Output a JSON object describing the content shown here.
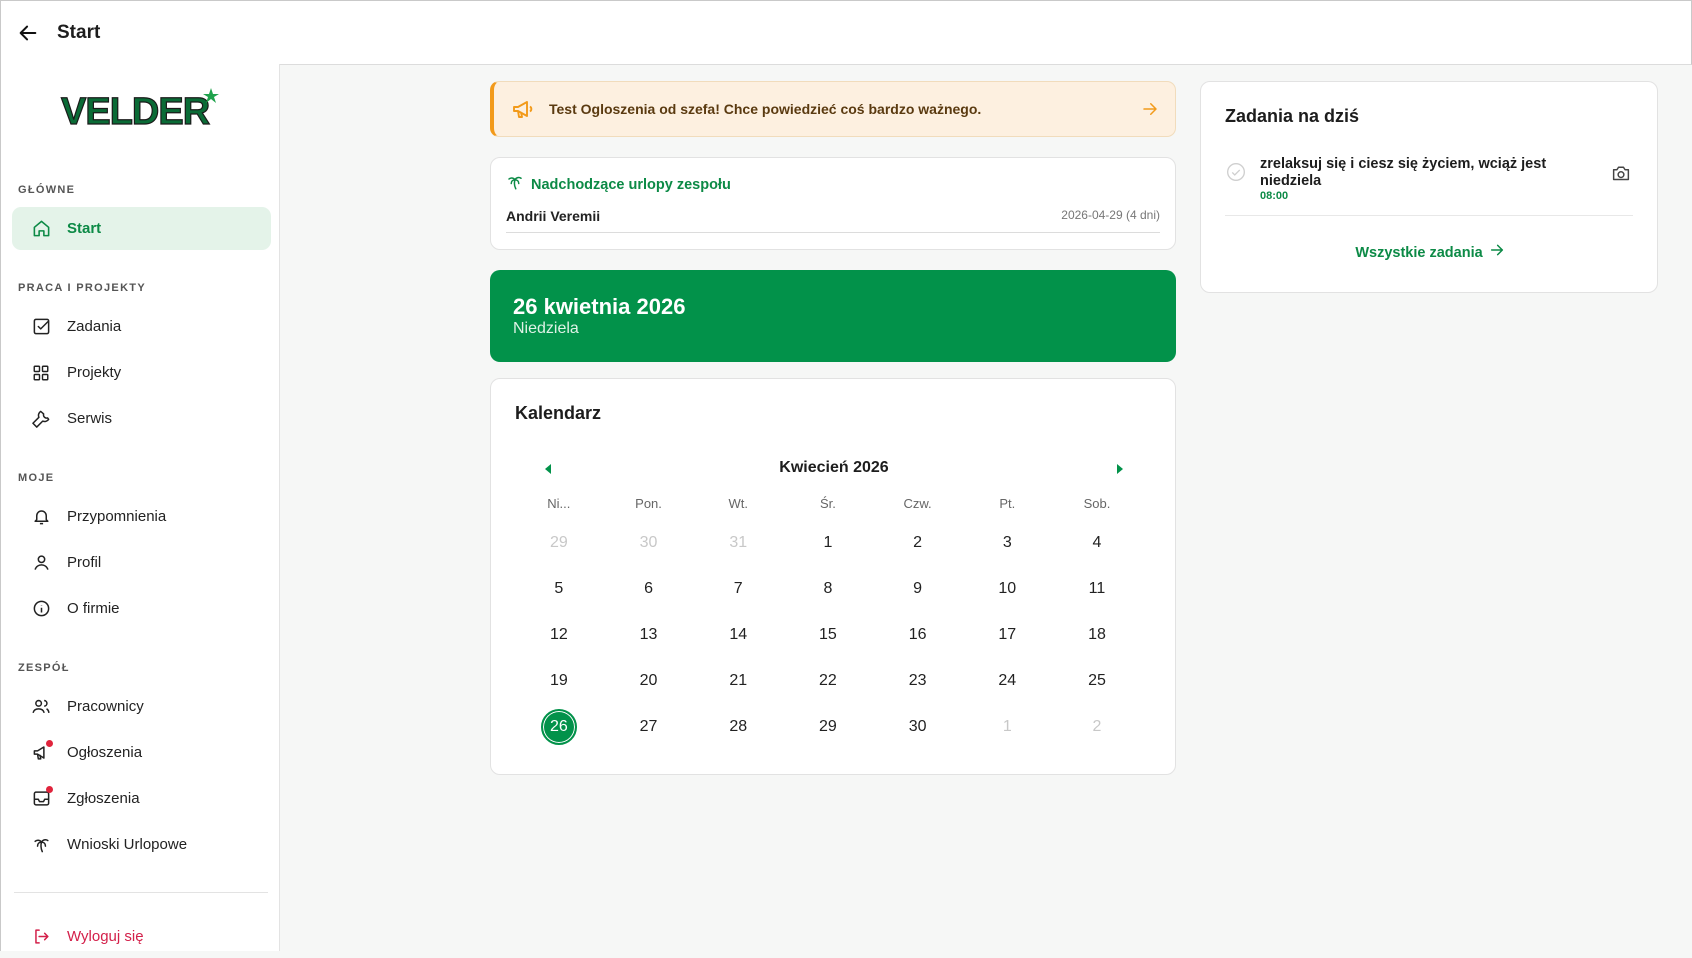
{
  "header": {
    "title": "Start"
  },
  "brand": {
    "logo_text": "VELDER",
    "color": "#0c8a46"
  },
  "sidebar": {
    "sections": [
      {
        "label": "GŁÓWNE"
      },
      {
        "label": "PRACA I PROJEKTY"
      },
      {
        "label": "MOJE"
      },
      {
        "label": "ZESPÓŁ"
      }
    ],
    "items": [
      {
        "label": "Start",
        "icon": "home-icon",
        "active": true
      },
      {
        "label": "Zadania",
        "icon": "check-square-icon"
      },
      {
        "label": "Projekty",
        "icon": "grid-icon"
      },
      {
        "label": "Serwis",
        "icon": "wrench-icon"
      },
      {
        "label": "Przypomnienia",
        "icon": "bell-icon"
      },
      {
        "label": "Profil",
        "icon": "user-icon"
      },
      {
        "label": "O firmie",
        "icon": "info-icon"
      },
      {
        "label": "Pracownicy",
        "icon": "users-icon"
      },
      {
        "label": "Ogłoszenia",
        "icon": "megaphone-icon",
        "badge": true
      },
      {
        "label": "Zgłoszenia",
        "icon": "inbox-icon",
        "badge": true
      },
      {
        "label": "Wnioski Urlopowe",
        "icon": "palm-tree-icon"
      }
    ],
    "logout": {
      "label": "Wyloguj się",
      "icon": "logout-icon"
    }
  },
  "announcement": {
    "text": "Test Ogloszenia od szefa! Chce powiedzieć coś bardzo ważnego."
  },
  "vacations": {
    "title": "Nadchodzące urlopy zespołu",
    "entries": [
      {
        "name": "Andrii Veremii",
        "dates": "2026-04-29 (4 dni)"
      }
    ]
  },
  "today": {
    "date": "26 kwietnia 2026",
    "weekday": "Niedziela"
  },
  "calendar": {
    "title": "Kalendarz",
    "month": "Kwiecień 2026",
    "weekdays": [
      "Ni...",
      "Pon.",
      "Wt.",
      "Śr.",
      "Czw.",
      "Pt.",
      "Sob."
    ],
    "weeks": [
      [
        "29",
        "30",
        "31",
        "1",
        "2",
        "3",
        "4"
      ],
      [
        "5",
        "6",
        "7",
        "8",
        "9",
        "10",
        "11"
      ],
      [
        "12",
        "13",
        "14",
        "15",
        "16",
        "17",
        "18"
      ],
      [
        "19",
        "20",
        "21",
        "22",
        "23",
        "24",
        "25"
      ],
      [
        "26",
        "27",
        "28",
        "29",
        "30",
        "1",
        "2"
      ]
    ],
    "today_day": "26"
  },
  "tasks": {
    "title": "Zadania na dziś",
    "items": [
      {
        "text": "zrelaksuj się i ciesz się życiem, wciąż jest niedziela",
        "time": "08:00"
      }
    ],
    "all_label": "Wszystkie zadania"
  }
}
